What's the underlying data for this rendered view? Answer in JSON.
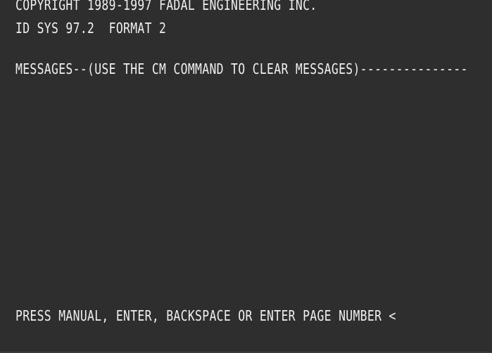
{
  "screen": {
    "copyright": "COPYRIGHT 1989-1997 FADAL ENGINEERING INC.",
    "id_line": "ID SYS 97.2  FORMAT 2",
    "messages_header": "MESSAGES--(USE THE CM COMMAND TO CLEAR MESSAGES)---------------",
    "prompt": "PRESS MANUAL, ENTER, BACKSPACE OR ENTER PAGE NUMBER <"
  },
  "colors": {
    "background": "#2e2e2e",
    "text": "#f0f0f0"
  }
}
